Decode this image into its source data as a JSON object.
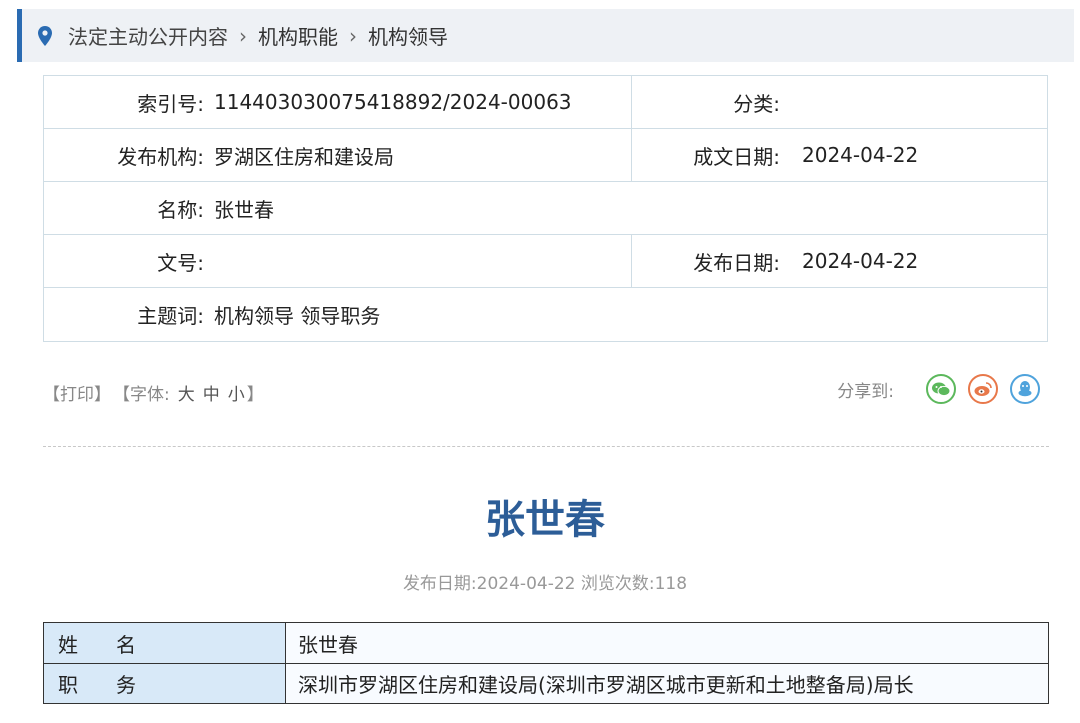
{
  "breadcrumb": {
    "items": [
      "法定主动公开内容",
      "机构职能",
      "机构领导"
    ],
    "separator": "›"
  },
  "info": {
    "index_label": "索引号:",
    "index_value": "11440303007541889​2/2024-00063",
    "category_label": "分类:",
    "category_value": "",
    "publisher_label": "发布机构:",
    "publisher_value": "罗湖区住房和建设局",
    "created_label": "成文日期:",
    "created_value": "2024-04-22",
    "name_label": "名称:",
    "name_value": "张世春",
    "docno_label": "文号:",
    "docno_value": "",
    "pubdate_label": "发布日期:",
    "pubdate_value": "2024-04-22",
    "keywords_label": "主题词:",
    "keywords_value": "机构领导 领导职务"
  },
  "tools": {
    "print": "【打印】",
    "font_prefix": "【字体:",
    "font_large": "大",
    "font_medium": "中",
    "font_small": "小",
    "font_suffix": "】",
    "share_label": "分享到:"
  },
  "share_colors": {
    "wechat": "#5cb85c",
    "weibo": "#e8784a",
    "qq": "#4fa3dc"
  },
  "article": {
    "title": "张世春",
    "meta": "发布日期:2024-04-22  浏览次数:118"
  },
  "detail": {
    "name_label": "姓名",
    "name_value": "张世春",
    "duty_label": "职务",
    "duty_value": "深圳市罗湖区住房和建设局(深圳市罗湖区城市更新和土地整备局)局长"
  }
}
